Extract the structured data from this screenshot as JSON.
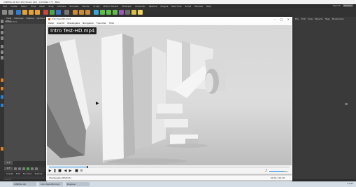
{
  "c4d": {
    "window_title": "CINEMA 4D R17.032 Studio (RC) - [Untitled 1 *] - Main",
    "menu": [
      "Edit",
      "Create",
      "Select",
      "Tools",
      "Mesh",
      "Snap",
      "Animate",
      "Simulate",
      "Render",
      "Sculpt",
      "Motion Tracker",
      "MoGraph",
      "Character",
      "Pipeline",
      "Plugins",
      "Real Flow",
      "Script",
      "Window",
      "Help"
    ],
    "layout_label": "Layout:",
    "layout_value": "Startup",
    "viewport_menu": [
      "View",
      "Cameras",
      "Display",
      "Options",
      "Filter"
    ],
    "viewport_label": "Perspective",
    "right_panel_tabs": [
      "File",
      "Edit",
      "View",
      "Objects",
      "Tags",
      "Bookmarks"
    ],
    "frame_start": "0 F",
    "frame_current": "0 F",
    "bottom_menu": [
      "Create",
      "Edit",
      "Function",
      "Texture"
    ],
    "status_text": "Cinema 4D"
  },
  "player": {
    "title": "Intro Test-HD.mp4",
    "menu": [
      "Datei",
      "Ansicht",
      "Wiedergabe",
      "Navigation",
      "Favoriten",
      "Hilfe"
    ],
    "overlay_title": "Intro Test-HD.mp4",
    "status": "Wiedergabe [NVIDIA]",
    "time": "00:02 / 00:18",
    "progress_fraction": 0.16,
    "volume_fraction": 0.8,
    "icons": {
      "minimize": "minimize-icon",
      "maximize": "maximize-icon",
      "close": "close-icon",
      "play": "play-icon",
      "pause": "pause-icon",
      "stop": "stop-icon",
      "previous": "previous-icon",
      "next": "next-icon",
      "volume": "speaker-icon",
      "cursor": "mouse-cursor-icon"
    }
  },
  "taskbar": {
    "tasks": [
      "CINEMA 4D",
      "Intro Test-HD.mp4",
      "Explorer"
    ],
    "clock": "11:42"
  },
  "colors": {
    "c4d_bg": "#3b3b3b",
    "accent": "#1e88e5"
  }
}
